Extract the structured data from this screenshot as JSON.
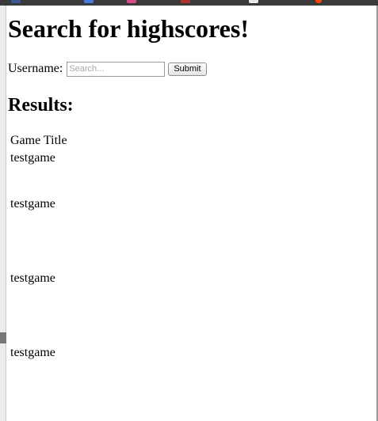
{
  "browser": {
    "tab_icon_colors": [
      "#3b5998",
      "#4a78d8",
      "#d94a8c",
      "#b03030",
      "#e8e8e8",
      "#ff4500"
    ]
  },
  "page": {
    "title": "Search for highscores!",
    "search": {
      "label": "Username:",
      "placeholder": "Search...",
      "value": "",
      "submit_label": "Submit"
    },
    "results_heading": "Results:",
    "results_table": {
      "column_header": "Game Title",
      "rows": [
        "testgame",
        "testgame",
        "testgame",
        "testgame"
      ]
    }
  }
}
